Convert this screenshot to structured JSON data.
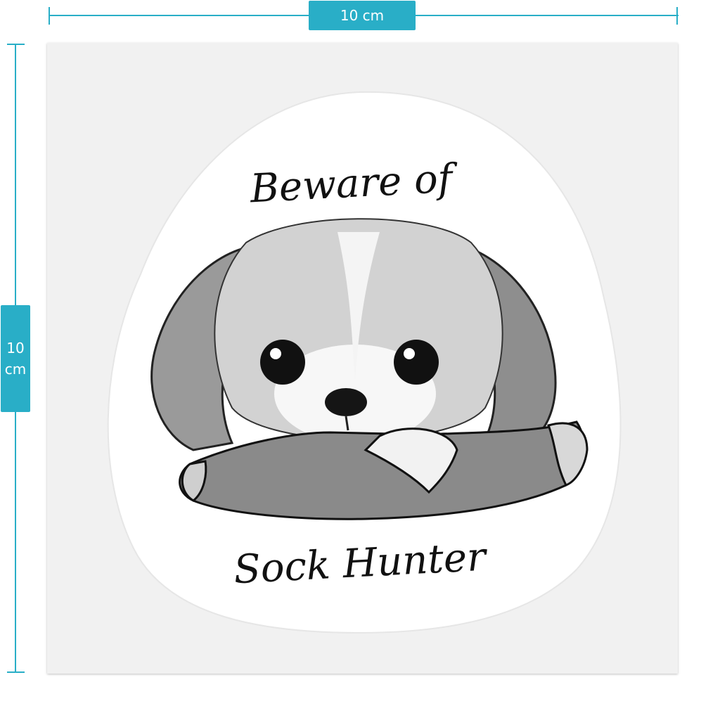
{
  "dimensions": {
    "width_label": "10 cm",
    "height_value": "10",
    "height_unit": "cm"
  },
  "sticker": {
    "top_text": "Beware of",
    "bottom_text": "Sock Hunter"
  },
  "colors": {
    "accent": "#29aec7",
    "sheet": "#f1f1f1",
    "sticker": "#ffffff",
    "ink": "#111111"
  }
}
